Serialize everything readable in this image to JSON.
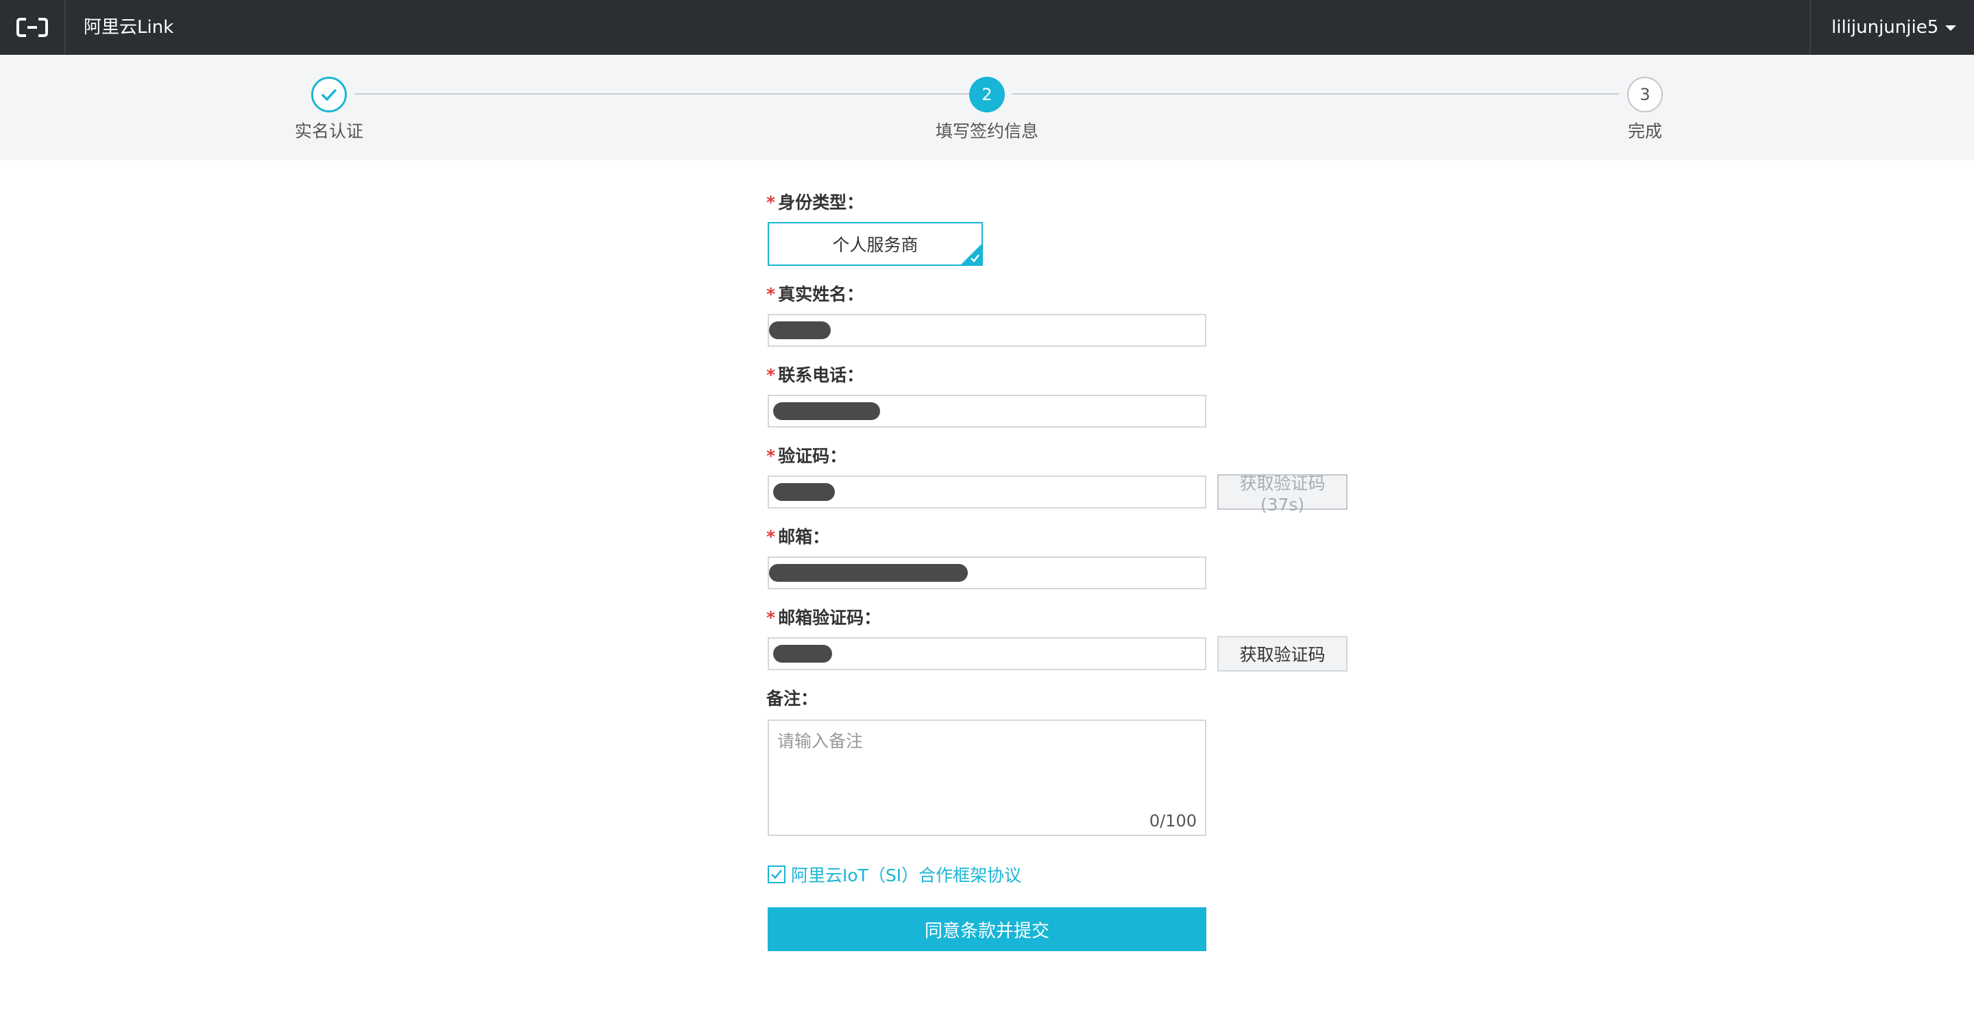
{
  "header": {
    "logo_icon": "aliyun-logo-icon",
    "app_title": "阿里云Link",
    "user_name": "lilijunjunjie5",
    "user_menu_icon": "caret-down-icon"
  },
  "steps": [
    {
      "label": "实名认证",
      "number": "",
      "status": "done",
      "icon": "check-icon"
    },
    {
      "label": "填写签约信息",
      "number": "2",
      "status": "active"
    },
    {
      "label": "完成",
      "number": "3",
      "status": "todo"
    }
  ],
  "form": {
    "identity_type": {
      "label": "身份类型：",
      "required": "*",
      "selected_option": "个人服务商"
    },
    "real_name": {
      "label": "真实姓名：",
      "required": "*",
      "value": "[redacted]"
    },
    "phone": {
      "label": "联系电话：",
      "required": "*",
      "value": "[redacted]"
    },
    "sms_code": {
      "label": "验证码：",
      "required": "*",
      "value": "[redacted]",
      "button_label": "获取验证码(37s)"
    },
    "email": {
      "label": "邮箱：",
      "required": "*",
      "value": "[redacted]"
    },
    "email_code": {
      "label": "邮箱验证码：",
      "required": "*",
      "value": "[redacted]",
      "button_label": "获取验证码"
    },
    "remark": {
      "label": "备注：",
      "placeholder": "请输入备注",
      "counter": "0/100"
    },
    "agreement": {
      "checked": true,
      "link_text": "阿里云IoT（SI）合作框架协议"
    },
    "submit_label": "同意条款并提交"
  },
  "colors": {
    "accent": "#19b5d6",
    "topbar": "#2b2f33",
    "required": "#e23b3b"
  }
}
